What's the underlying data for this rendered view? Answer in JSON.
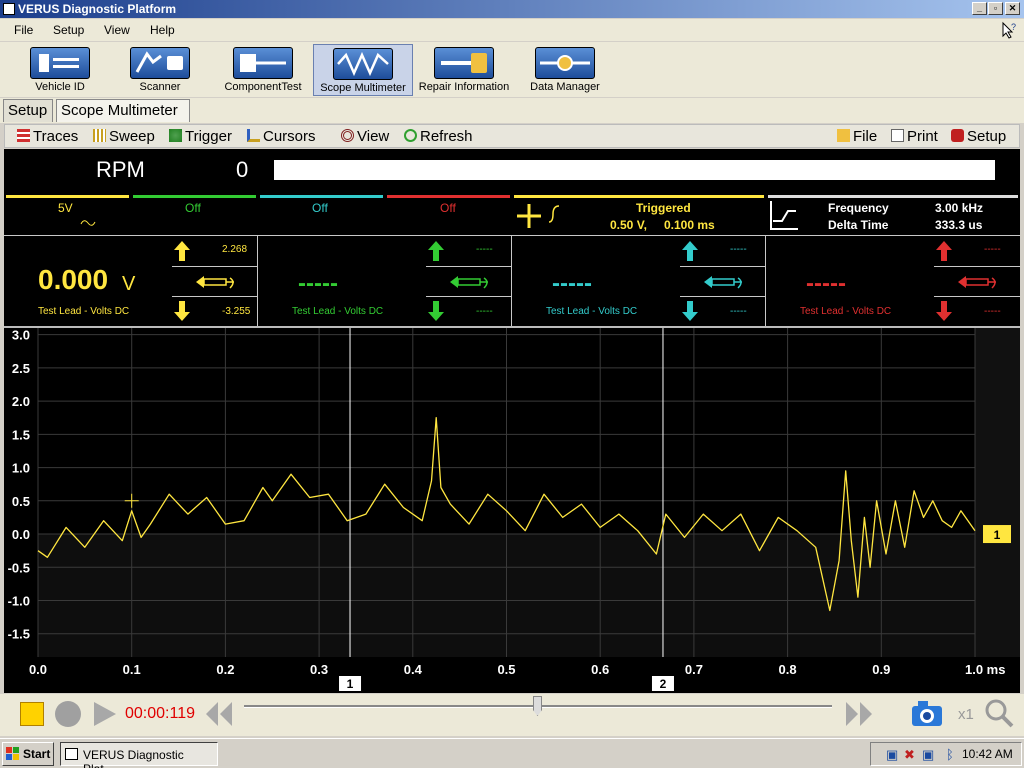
{
  "window": {
    "title": "VERUS Diagnostic Platform",
    "btn_min": "_",
    "btn_max": "▫",
    "btn_close": "✕"
  },
  "menu": [
    "File",
    "Setup",
    "View",
    "Help"
  ],
  "toolbar": {
    "items": [
      "Vehicle ID",
      "Scanner",
      "ComponentTest",
      "Scope Multimeter",
      "Repair Information",
      "Data Manager"
    ]
  },
  "tabs": [
    "Setup",
    "Scope Multimeter"
  ],
  "scope_toolbar": {
    "left": [
      "Traces",
      "Sweep",
      "Trigger",
      "Cursors",
      "View",
      "Refresh"
    ],
    "right": [
      "File",
      "Print",
      "Setup"
    ]
  },
  "rpm": {
    "label": "RPM",
    "value": "0"
  },
  "channels": [
    {
      "scale": "5V",
      "color": "#ffe640",
      "reading": "0.000",
      "unit": "V",
      "upper": "2.268",
      "lower": "-3.255",
      "desc": "Test Lead - Volts DC"
    },
    {
      "scale": "Off",
      "color": "#33cc33",
      "reading": "-----",
      "unit": "",
      "upper": "-----",
      "lower": "-----",
      "desc": "Test Lead - Volts DC"
    },
    {
      "scale": "Off",
      "color": "#33cccc",
      "reading": "-----",
      "unit": "",
      "upper": "-----",
      "lower": "-----",
      "desc": "Test Lead - Volts DC"
    },
    {
      "scale": "Off",
      "color": "#e03030",
      "reading": "-----",
      "unit": "",
      "upper": "-----",
      "lower": "-----",
      "desc": "Test Lead - Volts DC"
    }
  ],
  "trigger": {
    "status": "Triggered",
    "level": "0.50 V,",
    "time": "0.100 ms"
  },
  "cursor_info": {
    "freq_label": "Frequency",
    "freq_value": "3.00 kHz",
    "delta_label": "Delta Time",
    "delta_value": "333.3 us"
  },
  "chart_data": {
    "type": "line",
    "y_ticks": [
      "3.0",
      "2.5",
      "2.0",
      "1.5",
      "1.0",
      "0.5",
      "0.0",
      "-0.5",
      "-1.0",
      "-1.5"
    ],
    "x_ticks": [
      "0.0",
      "0.1",
      "0.2",
      "0.3",
      "0.4",
      "0.5",
      "0.6",
      "0.7",
      "0.8",
      "0.9",
      "1.0 ms"
    ],
    "xlim": [
      0,
      1.0
    ],
    "ylim": [
      -1.85,
      3.1
    ],
    "cursors": [
      {
        "label": "1",
        "x": 0.333
      },
      {
        "label": "2",
        "x": 0.667
      }
    ],
    "trace_marker": "1",
    "series": [
      {
        "color": "#ffe640",
        "x": [
          0,
          0.01,
          0.03,
          0.05,
          0.07,
          0.09,
          0.1,
          0.105,
          0.11,
          0.12,
          0.14,
          0.16,
          0.18,
          0.2,
          0.22,
          0.24,
          0.25,
          0.27,
          0.29,
          0.31,
          0.33,
          0.35,
          0.37,
          0.39,
          0.41,
          0.42,
          0.425,
          0.43,
          0.44,
          0.46,
          0.48,
          0.5,
          0.52,
          0.54,
          0.56,
          0.58,
          0.6,
          0.62,
          0.64,
          0.66,
          0.67,
          0.69,
          0.71,
          0.73,
          0.75,
          0.77,
          0.79,
          0.81,
          0.83,
          0.845,
          0.855,
          0.862,
          0.868,
          0.875,
          0.882,
          0.888,
          0.895,
          0.905,
          0.915,
          0.925,
          0.935,
          0.945,
          0.955,
          0.965,
          0.975,
          0.985,
          1.0
        ],
        "values": [
          -0.25,
          -0.35,
          0.1,
          -0.2,
          0.2,
          -0.1,
          0.35,
          0.15,
          -0.05,
          0.15,
          0.6,
          0.3,
          0.55,
          0.15,
          0.2,
          0.7,
          0.5,
          0.9,
          0.55,
          0.6,
          0.2,
          0.3,
          0.75,
          0.4,
          0.2,
          0.8,
          1.75,
          0.7,
          0.45,
          0.15,
          0.6,
          0.35,
          0.05,
          0.6,
          0.25,
          0.45,
          0.1,
          0.3,
          0.05,
          -0.3,
          0.3,
          -0.05,
          0.3,
          0.05,
          0.3,
          -0.25,
          0.25,
          0.05,
          -0.2,
          -1.15,
          -0.4,
          0.95,
          -0.1,
          -0.95,
          0.25,
          -0.5,
          0.5,
          -0.3,
          0.5,
          -0.2,
          0.65,
          0.25,
          0.5,
          0.2,
          0.1,
          0.35,
          0.05
        ]
      }
    ]
  },
  "playback": {
    "time": "00:00:119",
    "zoom": "x1",
    "position": 0.5
  },
  "taskbar": {
    "start": "Start",
    "task": "VERUS Diagnostic Plat...",
    "clock": "10:42 AM"
  }
}
